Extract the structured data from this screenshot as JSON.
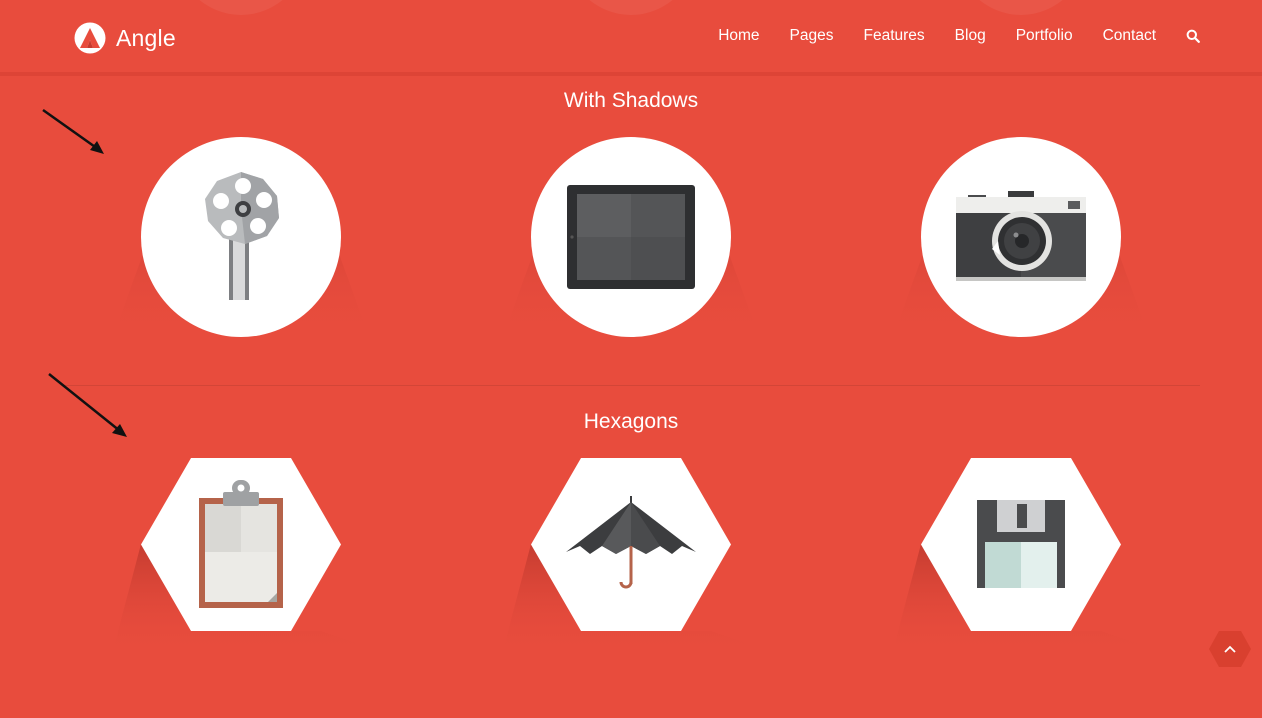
{
  "header": {
    "logo_text": "Angle",
    "nav": [
      "Home",
      "Pages",
      "Features",
      "Blog",
      "Portfolio",
      "Contact"
    ]
  },
  "sections": {
    "shadows_title": "With Shadows",
    "hexagons_title": "Hexagons"
  },
  "shadow_icons": [
    "film-reel-icon",
    "tablet-icon",
    "camera-icon"
  ],
  "hexagon_icons": [
    "clipboard-icon",
    "umbrella-icon",
    "floppy-disk-icon"
  ],
  "colors": {
    "background": "#e84c3d",
    "tile": "#ffffff",
    "shadow": "#c73a2e"
  }
}
